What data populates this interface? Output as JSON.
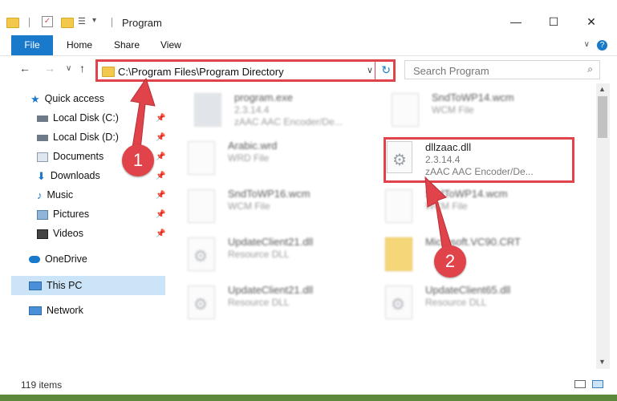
{
  "window": {
    "title": "Program",
    "minimize": "—",
    "maximize": "☐",
    "close": "✕"
  },
  "ribbon": {
    "tabs": [
      "File",
      "Home",
      "Share",
      "View"
    ],
    "help": "?"
  },
  "address": {
    "path": "C:\\Program Files\\Program Directory",
    "refresh": "↻",
    "dropdown": "∨"
  },
  "search": {
    "placeholder": "Search Program"
  },
  "sidebar": {
    "items": [
      {
        "label": "Quick access",
        "icon": "star-icon"
      },
      {
        "label": "Local Disk (C:)",
        "icon": "drive-icon"
      },
      {
        "label": "Local Disk (D:)",
        "icon": "drive-icon"
      },
      {
        "label": "Documents",
        "icon": "documents-icon"
      },
      {
        "label": "Downloads",
        "icon": "download-icon"
      },
      {
        "label": "Music",
        "icon": "music-icon"
      },
      {
        "label": "Pictures",
        "icon": "pictures-icon"
      },
      {
        "label": "Videos",
        "icon": "videos-icon"
      },
      {
        "label": "OneDrive",
        "icon": "cloud-icon"
      },
      {
        "label": "This PC",
        "icon": "computer-icon"
      },
      {
        "label": "Network",
        "icon": "network-icon"
      }
    ]
  },
  "files": [
    {
      "name": "program.exe",
      "line2": "2.3.14.4",
      "line3": "zAAC AAC Encoder/De...",
      "icon": "exe-icon"
    },
    {
      "name": "SndToWP14.wcm",
      "line2": "WCM File",
      "line3": "",
      "icon": "file-icon"
    },
    {
      "name": "Arabic.wrd",
      "line2": "WRD File",
      "line3": "",
      "icon": "file-icon"
    },
    {
      "name": "dllzaac.dll",
      "line2": "2.3.14.4",
      "line3": "zAAC AAC Encoder/De...",
      "icon": "dll-gear-icon"
    },
    {
      "name": "SndToWP16.wcm",
      "line2": "WCM File",
      "line3": "",
      "icon": "file-icon"
    },
    {
      "name": "SndToWP14.wcm",
      "line2": "WCM File",
      "line3": "",
      "icon": "file-icon"
    },
    {
      "name": "UpdateClient21.dll",
      "line2": "Resource DLL",
      "line3": "",
      "icon": "dll-gear-icon"
    },
    {
      "name": "Microsoft.VC90.CRT",
      "line2": "",
      "line3": "",
      "icon": "folder-icon"
    },
    {
      "name": "UpdateClient21.dll",
      "line2": "Resource DLL",
      "line3": "",
      "icon": "dll-gear-icon"
    },
    {
      "name": "UpdateClient65.dll",
      "line2": "Resource DLL",
      "line3": "",
      "icon": "dll-gear-icon"
    }
  ],
  "status": {
    "items_count": "119 items"
  },
  "annotations": {
    "badge1": "1",
    "badge2": "2",
    "color": "#e0434a"
  }
}
